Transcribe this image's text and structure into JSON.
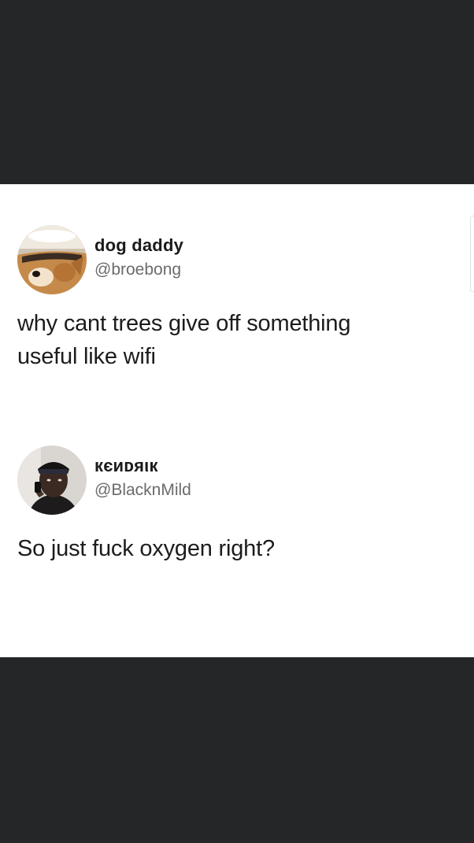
{
  "tweets": [
    {
      "display_name": "dog daddy",
      "handle": "@broebong",
      "avatar": "shiba-dog-avatar-icon",
      "text_lines": [
        "why cant trees give off something",
        "useful like wifi"
      ]
    },
    {
      "display_name": "кєиᴅяιк",
      "handle": "@BlacknMild",
      "avatar": "person-on-phone-avatar-icon",
      "text_lines": [
        "So just fuck oxygen right?"
      ]
    }
  ],
  "colors": {
    "background_dark": "#252628",
    "card_background": "#ffffff",
    "text_primary": "#1c1c1c",
    "text_secondary": "#6b6b6b"
  }
}
